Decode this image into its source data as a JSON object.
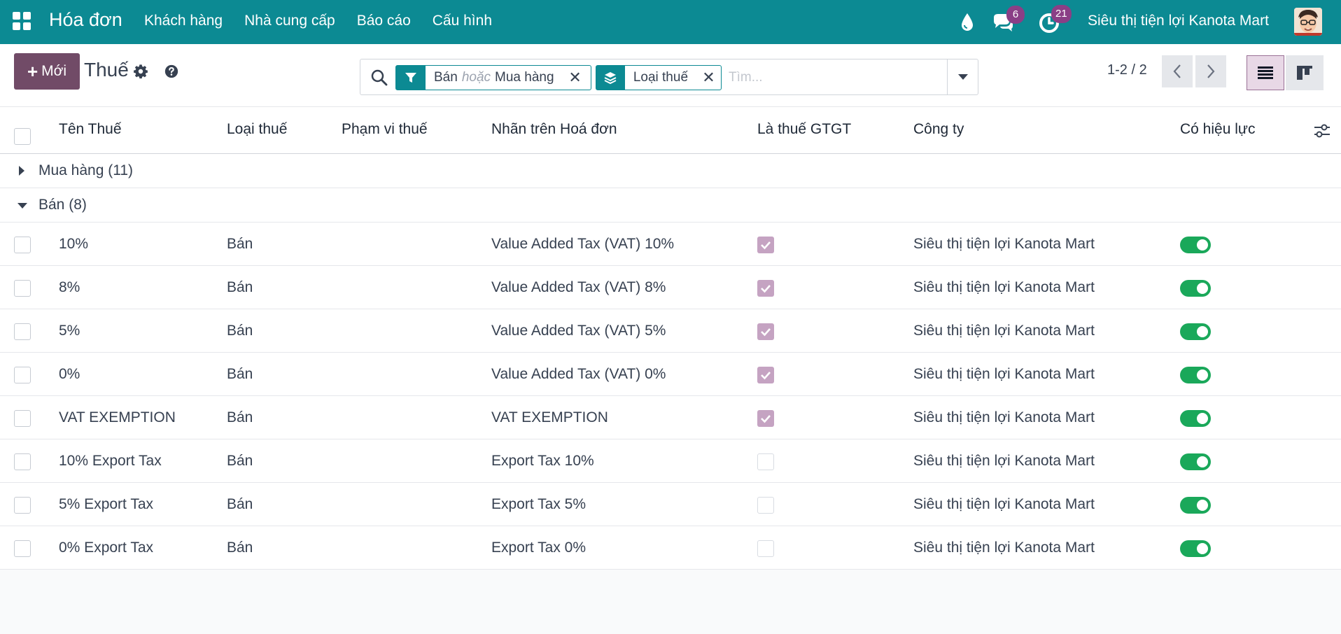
{
  "navbar": {
    "app_name": "Hóa đơn",
    "menu": [
      "Khách hàng",
      "Nhà cung cấp",
      "Báo cáo",
      "Cấu hình"
    ],
    "messages_count": "6",
    "activities_count": "21",
    "company": "Siêu thị tiện lợi Kanota Mart",
    "colors": {
      "bar": "#0c8a93",
      "badge": "#8a3f86"
    }
  },
  "control_panel": {
    "new_label": "Mới",
    "title": "Thuế",
    "search": {
      "facets": [
        {
          "icon": "filter-icon",
          "values": [
            "Bán",
            "Mua hàng"
          ],
          "separator": "hoặc"
        },
        {
          "icon": "group-by-icon",
          "values": [
            "Loại thuế"
          ]
        }
      ],
      "placeholder": "Tìm..."
    },
    "pager": "1-2 / 2"
  },
  "table": {
    "columns": [
      "Tên Thuế",
      "Loại thuế",
      "Phạm vi thuế",
      "Nhãn trên Hoá đơn",
      "Là thuế GTGT",
      "Công ty",
      "Có hiệu lực"
    ],
    "groups": [
      {
        "label": "Mua hàng (11)",
        "expanded": false
      },
      {
        "label": "Bán (8)",
        "expanded": true
      }
    ],
    "rows": [
      {
        "name": "10%",
        "type": "Bán",
        "scope": "",
        "invoice_label": "Value Added Tax (VAT) 10%",
        "is_vat": true,
        "company": "Siêu thị tiện lợi Kanota Mart",
        "active": true
      },
      {
        "name": "8%",
        "type": "Bán",
        "scope": "",
        "invoice_label": "Value Added Tax (VAT) 8%",
        "is_vat": true,
        "company": "Siêu thị tiện lợi Kanota Mart",
        "active": true
      },
      {
        "name": "5%",
        "type": "Bán",
        "scope": "",
        "invoice_label": "Value Added Tax (VAT) 5%",
        "is_vat": true,
        "company": "Siêu thị tiện lợi Kanota Mart",
        "active": true
      },
      {
        "name": "0%",
        "type": "Bán",
        "scope": "",
        "invoice_label": "Value Added Tax (VAT) 0%",
        "is_vat": true,
        "company": "Siêu thị tiện lợi Kanota Mart",
        "active": true
      },
      {
        "name": "VAT EXEMPTION",
        "type": "Bán",
        "scope": "",
        "invoice_label": "VAT EXEMPTION",
        "is_vat": true,
        "company": "Siêu thị tiện lợi Kanota Mart",
        "active": true
      },
      {
        "name": "10% Export Tax",
        "type": "Bán",
        "scope": "",
        "invoice_label": "Export Tax 10%",
        "is_vat": false,
        "company": "Siêu thị tiện lợi Kanota Mart",
        "active": true
      },
      {
        "name": "5% Export Tax",
        "type": "Bán",
        "scope": "",
        "invoice_label": "Export Tax 5%",
        "is_vat": false,
        "company": "Siêu thị tiện lợi Kanota Mart",
        "active": true
      },
      {
        "name": "0% Export Tax",
        "type": "Bán",
        "scope": "",
        "invoice_label": "Export Tax 0%",
        "is_vat": false,
        "company": "Siêu thị tiện lợi Kanota Mart",
        "active": true
      }
    ]
  }
}
